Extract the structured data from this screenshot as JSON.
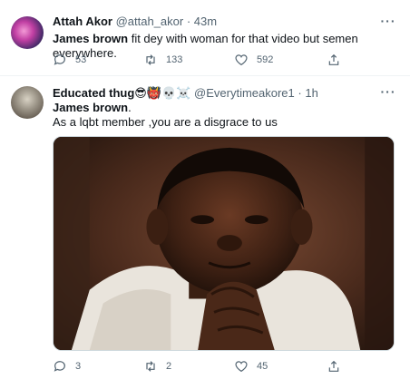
{
  "tweets": [
    {
      "name": "Attah Akor",
      "handle": "@attah_akor",
      "time": "· 43m",
      "text_bold": "James brown",
      "text_rest": " fit dey with woman for that video but semen everywhere.",
      "replies": "53",
      "retweets": "133",
      "likes": "592"
    },
    {
      "name": "Educated thug",
      "name_emoji": "😎👹💀☠️",
      "handle": "@Everytimeakore1",
      "time": "· 1h",
      "text_bold": "James brown",
      "text_after_bold": ".",
      "text_line2": "As a lqbt member ,you are a disgrace to us",
      "replies": "3",
      "retweets": "2",
      "likes": "45"
    }
  ],
  "icons": {
    "reply": "reply-icon",
    "retweet": "retweet-icon",
    "like": "heart-icon",
    "share": "share-icon",
    "more": "more-icon"
  },
  "colors": {
    "text": "#0f1419",
    "secondary": "#536471",
    "divider": "#eff3f4"
  }
}
